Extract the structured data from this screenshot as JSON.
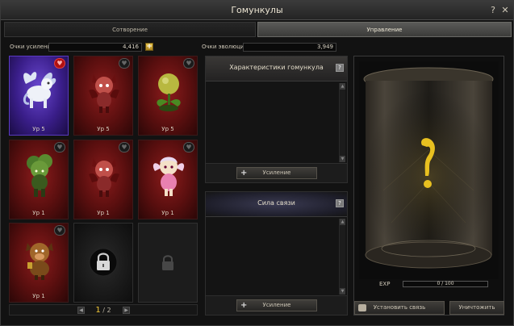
{
  "window": {
    "title": "Гомункулы",
    "help_icon": "question-icon",
    "close_icon": "close-icon"
  },
  "tabs": [
    {
      "label": "Сотворение",
      "active": false
    },
    {
      "label": "Управление",
      "active": true
    }
  ],
  "stats": {
    "boost_points_label": "Очки усиления",
    "boost_points_value": "4,416",
    "evolution_points_label": "Очки эволюции",
    "evolution_points_value": "3,949"
  },
  "homunculi": [
    {
      "level": "Ур 5",
      "theme": "purple",
      "favorite": true,
      "creature": "white-winged-pegasus"
    },
    {
      "level": "Ур 5",
      "theme": "red",
      "favorite": false,
      "creature": "red-imp"
    },
    {
      "level": "Ур 5",
      "theme": "red",
      "favorite": false,
      "creature": "yellow-bulb-plant"
    },
    {
      "level": "Ур 1",
      "theme": "red",
      "favorite": false,
      "creature": "green-treant"
    },
    {
      "level": "Ур 1",
      "theme": "red",
      "favorite": false,
      "creature": "red-imp"
    },
    {
      "level": "Ур 1",
      "theme": "red",
      "favorite": false,
      "creature": "pink-fairy"
    },
    {
      "level": "Ур 1",
      "theme": "red",
      "favorite": false,
      "creature": "brown-boar-warrior"
    },
    {
      "level": "",
      "theme": "locked",
      "favorite": false,
      "creature": "lock-icon"
    },
    {
      "level": "",
      "theme": "locked-dim",
      "favorite": false,
      "creature": "lock-icon"
    }
  ],
  "pager": {
    "current": "1",
    "separator": " / ",
    "total": "2"
  },
  "characteristics_panel": {
    "title": "Характеристики гомункула",
    "button_label": "Усиление"
  },
  "bond_panel": {
    "title": "Сила связи",
    "button_label": "Усиление"
  },
  "jar_panel": {
    "exp_label": "EXP",
    "exp_value": "0 / 100",
    "exp_fraction": 0,
    "center_icon": "exclamation-icon",
    "bind_button": "Установить связь",
    "destroy_button": "Уничтожить"
  },
  "colors": {
    "accent_gold": "#f2c838",
    "favorite_red": "#b01010",
    "slot_red": "#8c1c1c",
    "slot_purple": "#6a48d0"
  }
}
